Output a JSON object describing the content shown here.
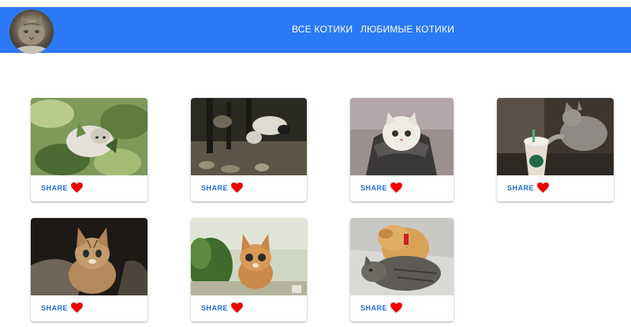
{
  "header": {
    "nav": [
      {
        "label": "ВСЕ КОТИКИ"
      },
      {
        "label": "ЛЮБИМЫЕ КОТИКИ"
      }
    ],
    "background_color": "#2b79f6"
  },
  "cards": [
    {
      "share_label": "SHARE",
      "liked": true
    },
    {
      "share_label": "SHARE",
      "liked": true
    },
    {
      "share_label": "SHARE",
      "liked": true
    },
    {
      "share_label": "SHARE",
      "liked": true
    },
    {
      "share_label": "SHARE",
      "liked": true
    },
    {
      "share_label": "SHARE",
      "liked": true
    },
    {
      "share_label": "SHARE",
      "liked": true
    }
  ],
  "colors": {
    "share": "#1e6fd9",
    "heart": "#ee0000",
    "accent": "#2b79f6"
  },
  "icons": {
    "favorite": "heart-icon",
    "avatar": "cat-avatar"
  }
}
